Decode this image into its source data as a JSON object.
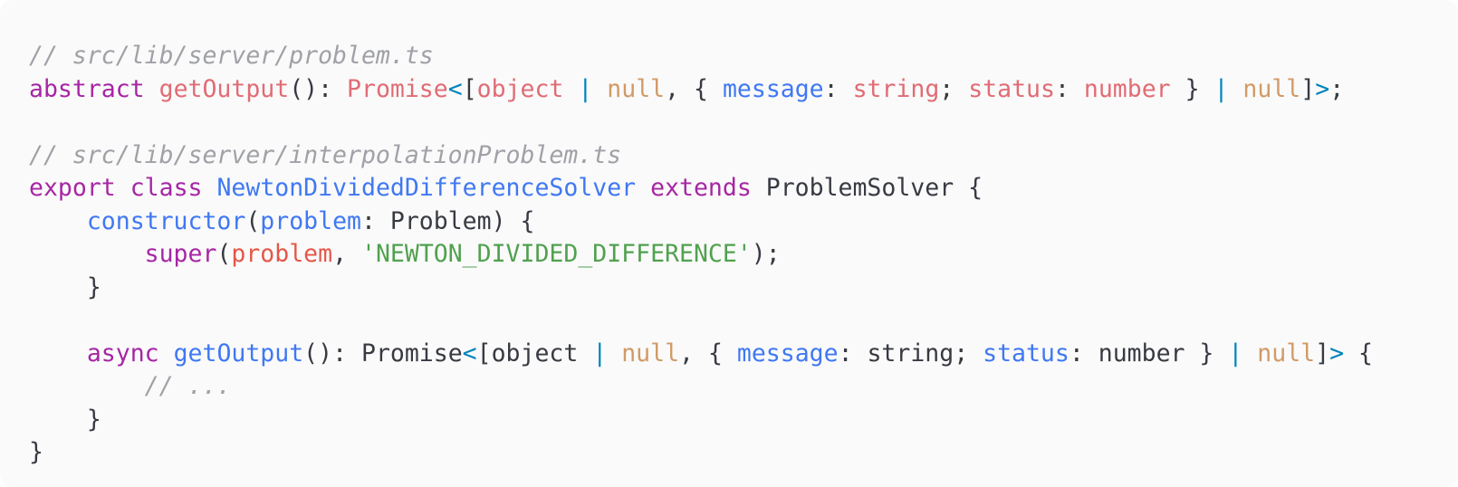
{
  "lines": [
    [
      {
        "t": "// src/lib/server/problem.ts",
        "c": "tok-comment"
      }
    ],
    [
      {
        "t": "abstract",
        "c": "tok-keyword"
      },
      {
        "t": " ",
        "c": "tok-plain"
      },
      {
        "t": "getOutput",
        "c": "tok-fn"
      },
      {
        "t": "(): ",
        "c": "tok-plain"
      },
      {
        "t": "Promise",
        "c": "tok-type"
      },
      {
        "t": "<",
        "c": "tok-op"
      },
      {
        "t": "[",
        "c": "tok-plain"
      },
      {
        "t": "object",
        "c": "tok-type"
      },
      {
        "t": " ",
        "c": "tok-plain"
      },
      {
        "t": "|",
        "c": "tok-op"
      },
      {
        "t": " ",
        "c": "tok-plain"
      },
      {
        "t": "null",
        "c": "tok-null2"
      },
      {
        "t": ", { ",
        "c": "tok-plain"
      },
      {
        "t": "message",
        "c": "tok-prop"
      },
      {
        "t": ": ",
        "c": "tok-plain"
      },
      {
        "t": "string",
        "c": "tok-type"
      },
      {
        "t": "; ",
        "c": "tok-plain"
      },
      {
        "t": "status",
        "c": "tok-type"
      },
      {
        "t": ": ",
        "c": "tok-plain"
      },
      {
        "t": "number",
        "c": "tok-type"
      },
      {
        "t": " } ",
        "c": "tok-plain"
      },
      {
        "t": "|",
        "c": "tok-op"
      },
      {
        "t": " ",
        "c": "tok-plain"
      },
      {
        "t": "null",
        "c": "tok-null2"
      },
      {
        "t": "]",
        "c": "tok-plain"
      },
      {
        "t": ">",
        "c": "tok-op"
      },
      {
        "t": ";",
        "c": "tok-plain"
      }
    ],
    [],
    [
      {
        "t": "// src/lib/server/interpolationProblem.ts",
        "c": "tok-comment"
      }
    ],
    [
      {
        "t": "export",
        "c": "tok-keyword"
      },
      {
        "t": " ",
        "c": "tok-plain"
      },
      {
        "t": "class",
        "c": "tok-keyword"
      },
      {
        "t": " ",
        "c": "tok-plain"
      },
      {
        "t": "NewtonDividedDifferenceSolver",
        "c": "tok-func"
      },
      {
        "t": " ",
        "c": "tok-plain"
      },
      {
        "t": "extends",
        "c": "tok-keyword"
      },
      {
        "t": " ProblemSolver {",
        "c": "tok-plain"
      }
    ],
    [
      {
        "t": "    ",
        "c": "tok-plain"
      },
      {
        "t": "constructor",
        "c": "tok-func"
      },
      {
        "t": "(",
        "c": "tok-plain"
      },
      {
        "t": "problem",
        "c": "tok-prop"
      },
      {
        "t": ": Problem) {",
        "c": "tok-plain"
      }
    ],
    [
      {
        "t": "        ",
        "c": "tok-plain"
      },
      {
        "t": "super",
        "c": "tok-keyword"
      },
      {
        "t": "(",
        "c": "tok-plain"
      },
      {
        "t": "problem",
        "c": "tok-param"
      },
      {
        "t": ", ",
        "c": "tok-plain"
      },
      {
        "t": "'NEWTON_DIVIDED_DIFFERENCE'",
        "c": "tok-string"
      },
      {
        "t": ");",
        "c": "tok-plain"
      }
    ],
    [
      {
        "t": "    }",
        "c": "tok-plain"
      }
    ],
    [],
    [
      {
        "t": "    ",
        "c": "tok-plain"
      },
      {
        "t": "async",
        "c": "tok-keyword"
      },
      {
        "t": " ",
        "c": "tok-plain"
      },
      {
        "t": "getOutput",
        "c": "tok-func"
      },
      {
        "t": "(): Promise",
        "c": "tok-plain"
      },
      {
        "t": "<",
        "c": "tok-op"
      },
      {
        "t": "[object ",
        "c": "tok-plain"
      },
      {
        "t": "|",
        "c": "tok-op"
      },
      {
        "t": " ",
        "c": "tok-plain"
      },
      {
        "t": "null",
        "c": "tok-null2"
      },
      {
        "t": ", { ",
        "c": "tok-plain"
      },
      {
        "t": "message",
        "c": "tok-prop"
      },
      {
        "t": ": string; ",
        "c": "tok-plain"
      },
      {
        "t": "status",
        "c": "tok-prop"
      },
      {
        "t": ": number } ",
        "c": "tok-plain"
      },
      {
        "t": "|",
        "c": "tok-op"
      },
      {
        "t": " ",
        "c": "tok-plain"
      },
      {
        "t": "null",
        "c": "tok-null2"
      },
      {
        "t": "]",
        "c": "tok-plain"
      },
      {
        "t": ">",
        "c": "tok-op"
      },
      {
        "t": " {",
        "c": "tok-plain"
      }
    ],
    [
      {
        "t": "        ",
        "c": "tok-plain"
      },
      {
        "t": "// ...",
        "c": "tok-comment"
      }
    ],
    [
      {
        "t": "    }",
        "c": "tok-plain"
      }
    ],
    [
      {
        "t": "}",
        "c": "tok-plain"
      }
    ]
  ]
}
